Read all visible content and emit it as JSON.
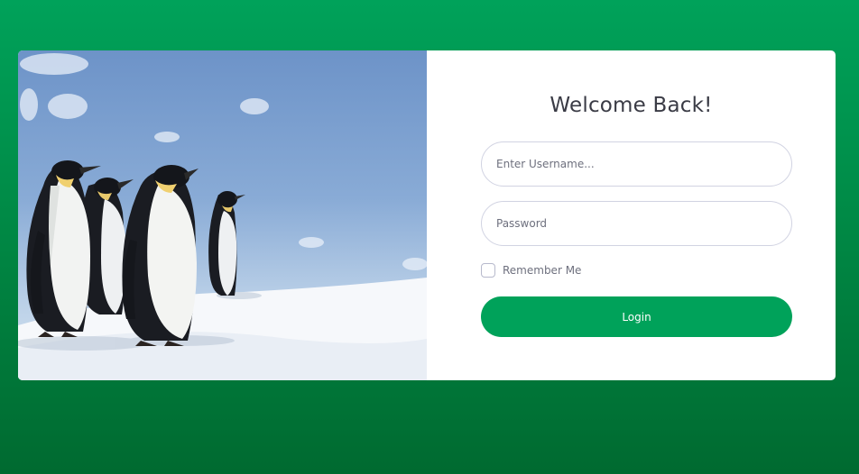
{
  "login": {
    "title": "Welcome Back!",
    "username_placeholder": "Enter Username...",
    "password_placeholder": "Password",
    "remember_label": "Remember Me",
    "login_label": "Login"
  },
  "colors": {
    "background_top": "#00a25a",
    "background_bottom": "#006a30",
    "button": "#00a25a",
    "card": "#ffffff"
  }
}
